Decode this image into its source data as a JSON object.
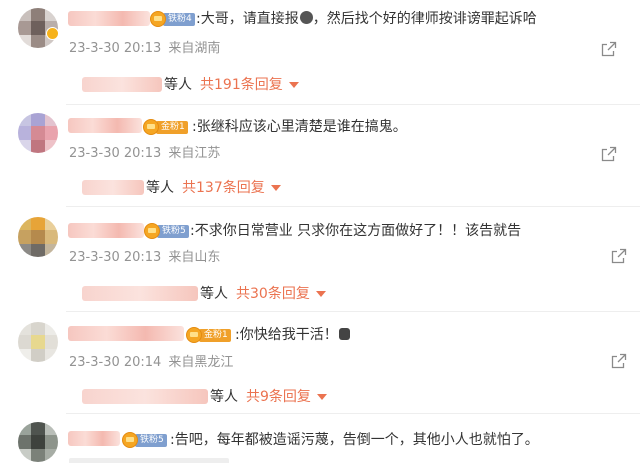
{
  "comments": [
    {
      "badge": "铁粉4",
      "text": ":大哥，请直接报",
      "text_after": "，然后找个好的律师按诽谤罪起诉哈",
      "date": "23-3-30 20:13",
      "location": "来自湖南",
      "reply_who": "等人",
      "reply_count": "共191条回复"
    },
    {
      "badge": "金粉1",
      "text": ":张继科应该心里清楚是谁在搞鬼。",
      "date": "23-3-30 20:13",
      "location": "来自江苏",
      "reply_who": "等人",
      "reply_count": "共137条回复"
    },
    {
      "badge": "铁粉5",
      "text": ":不求你日常营业 只求你在这方面做好了！！该告就告",
      "date": "23-3-30 20:13",
      "location": "来自山东",
      "reply_who": "等人",
      "reply_count": "共30条回复"
    },
    {
      "badge": "金粉1",
      "text": ":你快给我干活！",
      "date": "23-3-30 20:14",
      "location": "来自黑龙江",
      "reply_who": "等人",
      "reply_count": "共9条回复"
    },
    {
      "badge": "铁粉5",
      "text": ":告吧，每年都被造谣污蔑，告倒一个，其他小人也就怕了。"
    }
  ],
  "icons": {
    "share": "share-icon",
    "expand": "caret-down-icon",
    "crown": "crown-icon"
  },
  "colors": {
    "accent": "#eb7350",
    "meta": "#939393",
    "iron_badge": "#7f9fcf",
    "gold_badge": "#f0a02a"
  }
}
